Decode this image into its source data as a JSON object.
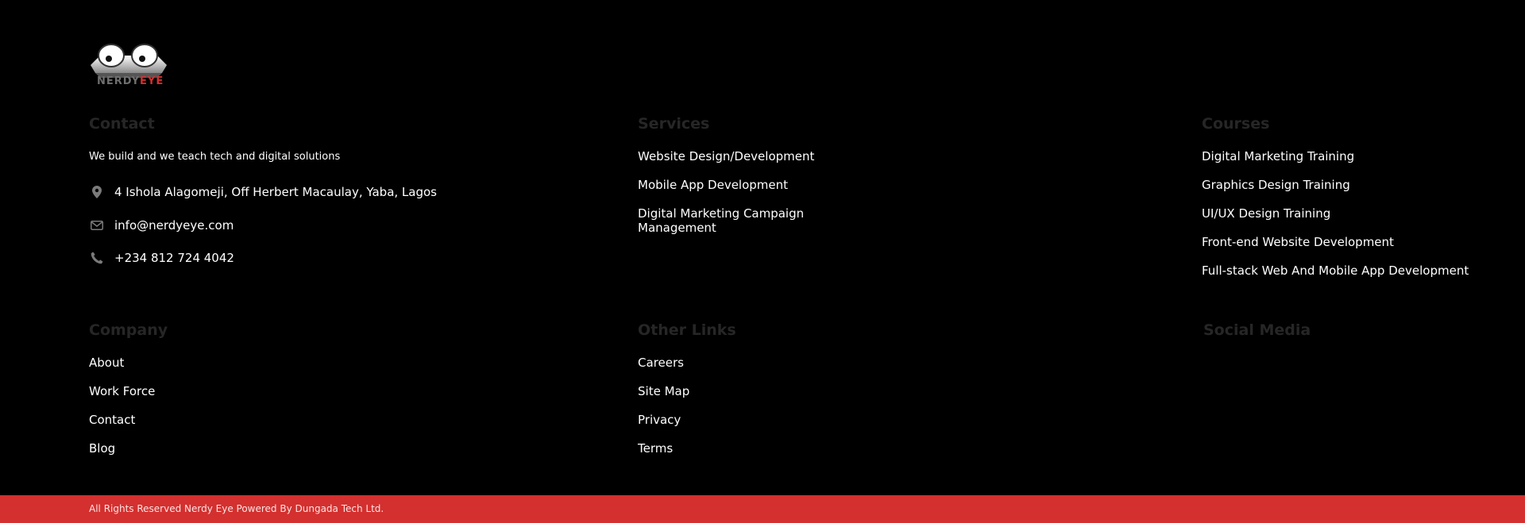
{
  "brand": {
    "logo_word_1": "NERDY",
    "logo_word_2": "EYE",
    "accent": "#d3302f",
    "heading_color": "#262626"
  },
  "contact": {
    "heading": "Contact",
    "tagline": "We build and we teach tech and digital solutions",
    "address": {
      "icon": "map-pin-icon",
      "text": "4 Ishola Alagomeji, Off Herbert Macaulay, Yaba, Lagos"
    },
    "email": {
      "icon": "mail-icon",
      "text": "info@nerdyeye.com"
    },
    "phone": {
      "icon": "phone-icon",
      "text": "+234 812 724 4042"
    }
  },
  "services": {
    "heading": "Services",
    "items": [
      "Website Design/Development",
      "Mobile App Development",
      "Digital Marketing Campaign Management"
    ]
  },
  "courses": {
    "heading": "Courses",
    "items": [
      "Digital Marketing Training",
      "Graphics Design Training",
      "UI/UX Design Training",
      "Front-end Website Development",
      "Full-stack Web And Mobile App Development"
    ]
  },
  "company": {
    "heading": "Company",
    "items": [
      "About",
      "Work Force",
      "Contact",
      "Blog"
    ]
  },
  "other_links": {
    "heading": "Other Links",
    "items": [
      "Careers",
      "Site Map",
      "Privacy",
      "Terms"
    ]
  },
  "social": {
    "heading": "Social Media"
  },
  "bottom_bar": {
    "copyright": "All Rights Reserved Nerdy Eye Powered By Dungada Tech Ltd."
  }
}
